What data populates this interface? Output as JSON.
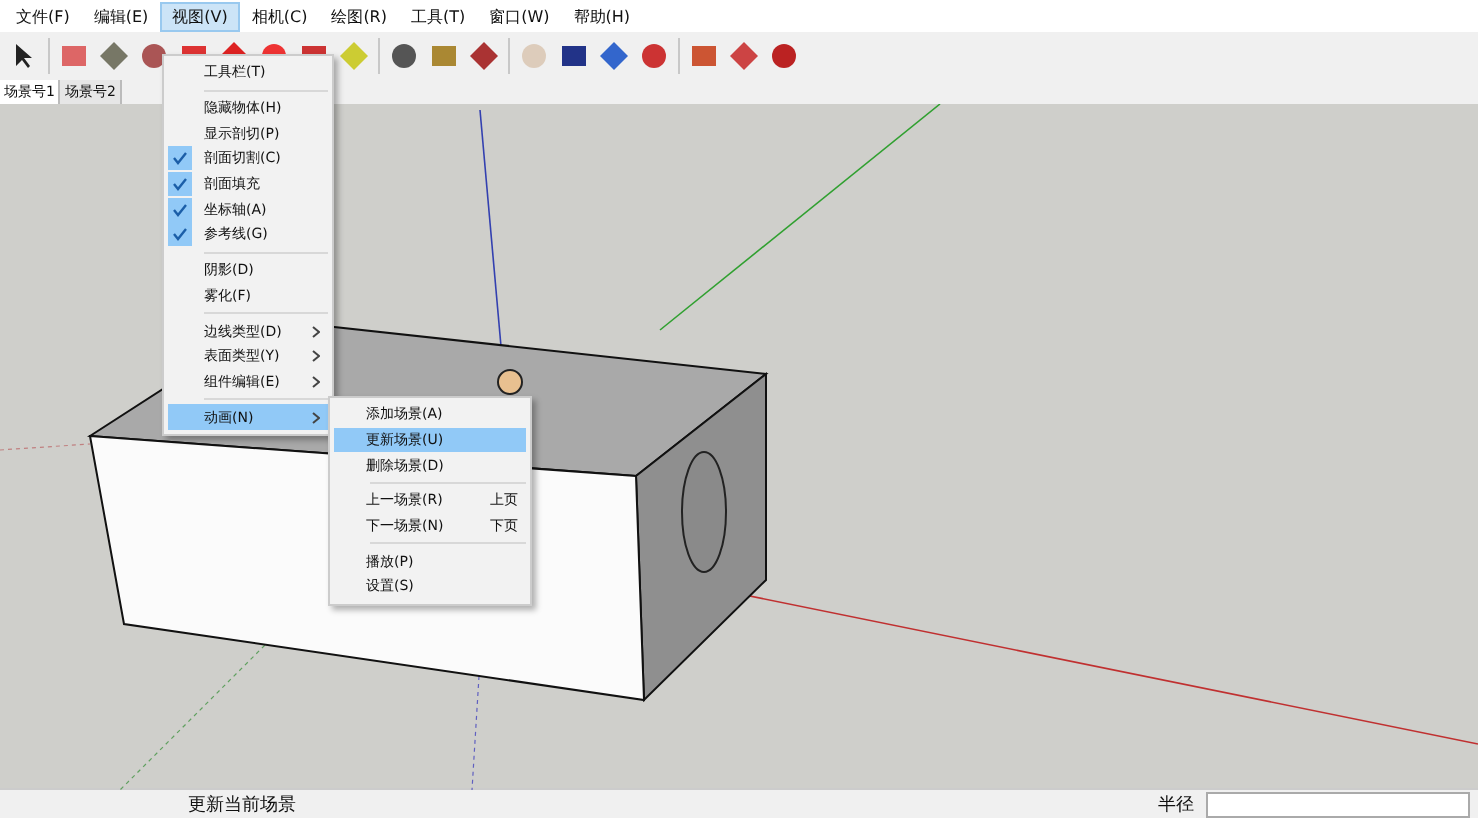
{
  "menubar": [
    {
      "label": "文件(F)",
      "selected": false
    },
    {
      "label": "编辑(E)",
      "selected": false
    },
    {
      "label": "视图(V)",
      "selected": true
    },
    {
      "label": "相机(C)",
      "selected": false
    },
    {
      "label": "绘图(R)",
      "selected": false
    },
    {
      "label": "工具(T)",
      "selected": false
    },
    {
      "label": "窗口(W)",
      "selected": false
    },
    {
      "label": "帮助(H)",
      "selected": false
    }
  ],
  "scene_tabs": [
    {
      "label": "场景号1",
      "selected": true
    },
    {
      "label": "场景号2",
      "selected": false
    }
  ],
  "view_menu": {
    "groups": [
      [
        {
          "label": "工具栏(T)",
          "checked": false,
          "submenu": false,
          "selected": false
        }
      ],
      [
        {
          "label": "隐藏物体(H)",
          "checked": false,
          "submenu": false,
          "selected": false
        },
        {
          "label": "显示剖切(P)",
          "checked": false,
          "submenu": false,
          "selected": false
        },
        {
          "label": "剖面切割(C)",
          "checked": true,
          "submenu": false,
          "selected": false
        },
        {
          "label": "剖面填充",
          "checked": true,
          "submenu": false,
          "selected": false
        },
        {
          "label": "坐标轴(A)",
          "checked": true,
          "submenu": false,
          "selected": false
        },
        {
          "label": "参考线(G)",
          "checked": true,
          "submenu": false,
          "selected": false
        }
      ],
      [
        {
          "label": "阴影(D)",
          "checked": false,
          "submenu": false,
          "selected": false
        },
        {
          "label": "雾化(F)",
          "checked": false,
          "submenu": false,
          "selected": false
        }
      ],
      [
        {
          "label": "边线类型(D)",
          "checked": false,
          "submenu": true,
          "selected": false
        },
        {
          "label": "表面类型(Y)",
          "checked": false,
          "submenu": true,
          "selected": false
        },
        {
          "label": "组件编辑(E)",
          "checked": false,
          "submenu": true,
          "selected": false
        }
      ],
      [
        {
          "label": "动画(N)",
          "checked": false,
          "submenu": true,
          "selected": true
        }
      ]
    ]
  },
  "animation_submenu": {
    "groups": [
      [
        {
          "label": "添加场景(A)",
          "selected": false
        },
        {
          "label": "更新场景(U)",
          "selected": true
        },
        {
          "label": "删除场景(D)",
          "selected": false
        }
      ],
      [
        {
          "label": "上一场景(R)",
          "shortcut": "上页",
          "selected": false
        },
        {
          "label": "下一场景(N)",
          "shortcut": "下页",
          "selected": false
        }
      ],
      [
        {
          "label": "播放(P)",
          "selected": false
        },
        {
          "label": "设置(S)",
          "selected": false
        }
      ]
    ]
  },
  "status_bar": {
    "message": "更新当前场景",
    "measurement_label": "半径"
  }
}
